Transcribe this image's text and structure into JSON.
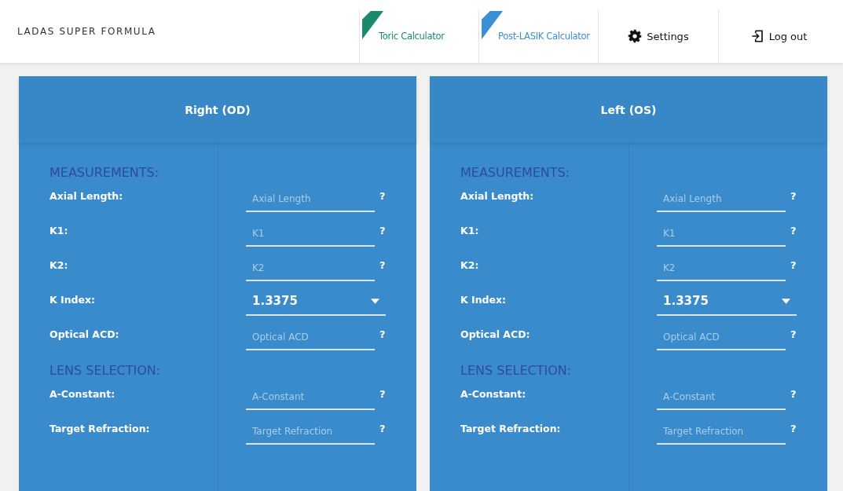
{
  "brand": "LADAS SUPER FORMULA",
  "nav": [
    {
      "kind": "ribbon",
      "label": "Toric Calculator",
      "color": "#1a8a6e"
    },
    {
      "kind": "ribbon",
      "label": "Post-LASIK Calculator",
      "color": "#3a8fd6"
    },
    {
      "kind": "settings",
      "label": "Settings"
    },
    {
      "kind": "logout",
      "label": "Log out"
    }
  ],
  "panels": [
    {
      "title": "Right (OD)",
      "rows": [
        {
          "kind": "heading",
          "label": "MEASUREMENTS:"
        },
        {
          "kind": "input",
          "label": "Axial Length:",
          "placeholder": "Axial Length",
          "help": "?"
        },
        {
          "kind": "input",
          "label": "K1:",
          "placeholder": "K1",
          "help": "?"
        },
        {
          "kind": "input",
          "label": "K2:",
          "placeholder": "K2",
          "help": "?"
        },
        {
          "kind": "select",
          "label": "K Index:",
          "value": "1.3375"
        },
        {
          "kind": "input",
          "label": "Optical ACD:",
          "placeholder": "Optical ACD",
          "help": "?"
        },
        {
          "kind": "heading",
          "label": "LENS SELECTION:"
        },
        {
          "kind": "input",
          "label": "A-Constant:",
          "placeholder": "A-Constant",
          "help": "?"
        },
        {
          "kind": "input",
          "label": "Target Refraction:",
          "placeholder": "Target Refraction",
          "help": "?"
        }
      ]
    },
    {
      "title": "Left (OS)",
      "rows": [
        {
          "kind": "heading",
          "label": "MEASUREMENTS:"
        },
        {
          "kind": "input",
          "label": "Axial Length:",
          "placeholder": "Axial Length",
          "help": "?"
        },
        {
          "kind": "input",
          "label": "K1:",
          "placeholder": "K1",
          "help": "?"
        },
        {
          "kind": "input",
          "label": "K2:",
          "placeholder": "K2",
          "help": "?"
        },
        {
          "kind": "select",
          "label": "K Index:",
          "value": "1.3375"
        },
        {
          "kind": "input",
          "label": "Optical ACD:",
          "placeholder": "Optical ACD",
          "help": "?"
        },
        {
          "kind": "heading",
          "label": "LENS SELECTION:"
        },
        {
          "kind": "input",
          "label": "A-Constant:",
          "placeholder": "A-Constant",
          "help": "?"
        },
        {
          "kind": "input",
          "label": "Target Refraction:",
          "placeholder": "Target Refraction",
          "help": "?"
        }
      ]
    }
  ]
}
